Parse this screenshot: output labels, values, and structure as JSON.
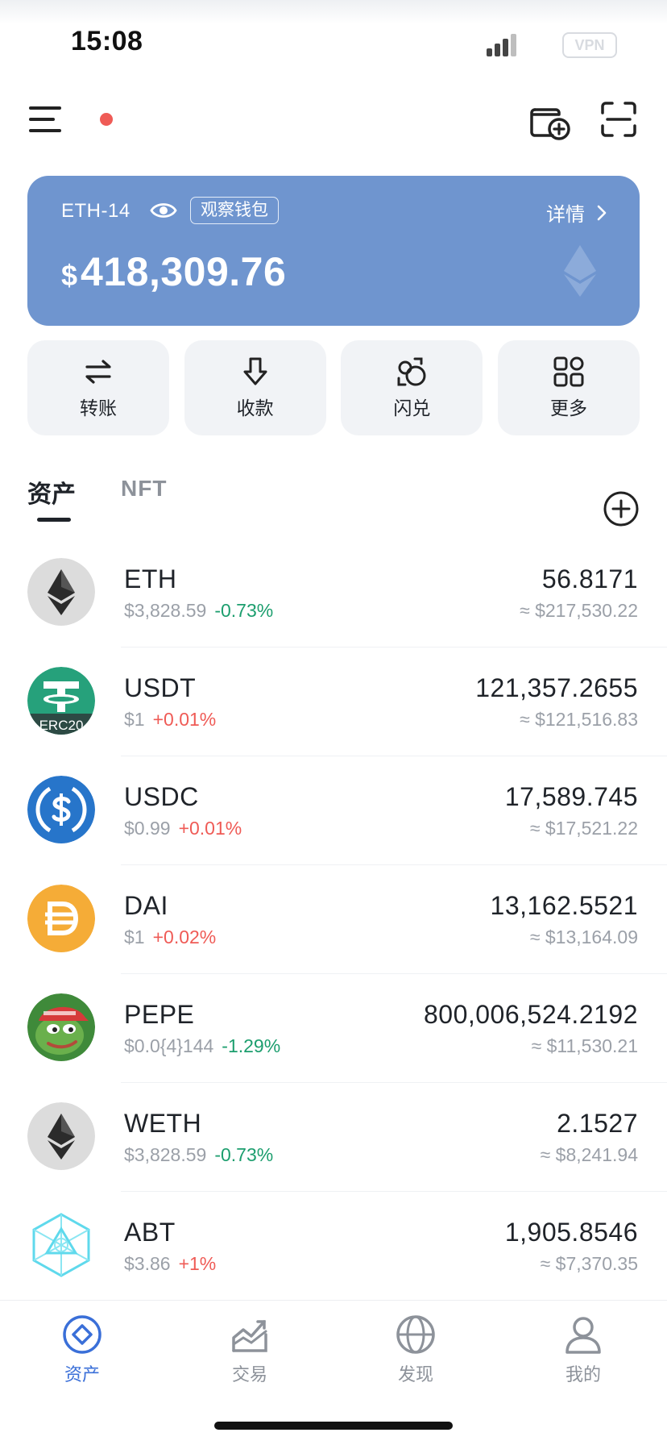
{
  "status_bar": {
    "time": "15:08",
    "vpn_label": "VPN",
    "signal_icon": "signal-icon"
  },
  "top_nav": {
    "menu_icon": "menu-icon",
    "wallet_add_icon": "wallet-add-icon",
    "scan_icon": "scan-icon"
  },
  "wallet_card": {
    "name": "ETH-14",
    "badge": "观察钱包",
    "detail_label": "详情",
    "currency": "$",
    "balance": "418,309.76",
    "background_color": "#6f95cf"
  },
  "actions": [
    {
      "label": "转账",
      "icon": "transfer-icon"
    },
    {
      "label": "收款",
      "icon": "receive-icon"
    },
    {
      "label": "闪兑",
      "icon": "swap-icon"
    },
    {
      "label": "更多",
      "icon": "more-grid-icon"
    }
  ],
  "tabs": {
    "assets": "资产",
    "nft": "NFT"
  },
  "tokens": [
    {
      "symbol": "ETH",
      "price": "$3,828.59",
      "change": "-0.73%",
      "amount": "56.8171",
      "value": "≈ $217,530.22",
      "icon": "eth-icon"
    },
    {
      "symbol": "USDT",
      "price": "$1",
      "change": "+0.01%",
      "amount": "121,357.2655",
      "value": "≈ $121,516.83",
      "icon": "usdt-icon",
      "icon_label": "ERC20"
    },
    {
      "symbol": "USDC",
      "price": "$0.99",
      "change": "+0.01%",
      "amount": "17,589.745",
      "value": "≈ $17,521.22",
      "icon": "usdc-icon"
    },
    {
      "symbol": "DAI",
      "price": "$1",
      "change": "+0.02%",
      "amount": "13,162.5521",
      "value": "≈ $13,164.09",
      "icon": "dai-icon"
    },
    {
      "symbol": "PEPE",
      "price": "$0.0{4}144",
      "change": "-1.29%",
      "amount": "800,006,524.2192",
      "value": "≈ $11,530.21",
      "icon": "pepe-icon"
    },
    {
      "symbol": "WETH",
      "price": "$3,828.59",
      "change": "-0.73%",
      "amount": "2.1527",
      "value": "≈ $8,241.94",
      "icon": "weth-icon"
    },
    {
      "symbol": "ABT",
      "price": "$3.86",
      "change": "+1%",
      "amount": "1,905.8546",
      "value": "≈ $7,370.35",
      "icon": "abt-icon"
    }
  ],
  "bottom_nav": [
    {
      "label": "资产",
      "icon": "assets-icon",
      "active": true
    },
    {
      "label": "交易",
      "icon": "trade-chart-icon",
      "active": false
    },
    {
      "label": "发现",
      "icon": "discover-globe-icon",
      "active": false
    },
    {
      "label": "我的",
      "icon": "profile-icon",
      "active": false
    }
  ],
  "colors": {
    "negative": "#1c9e6e",
    "positive": "#ef5b56",
    "accent": "#3a6fd8"
  }
}
